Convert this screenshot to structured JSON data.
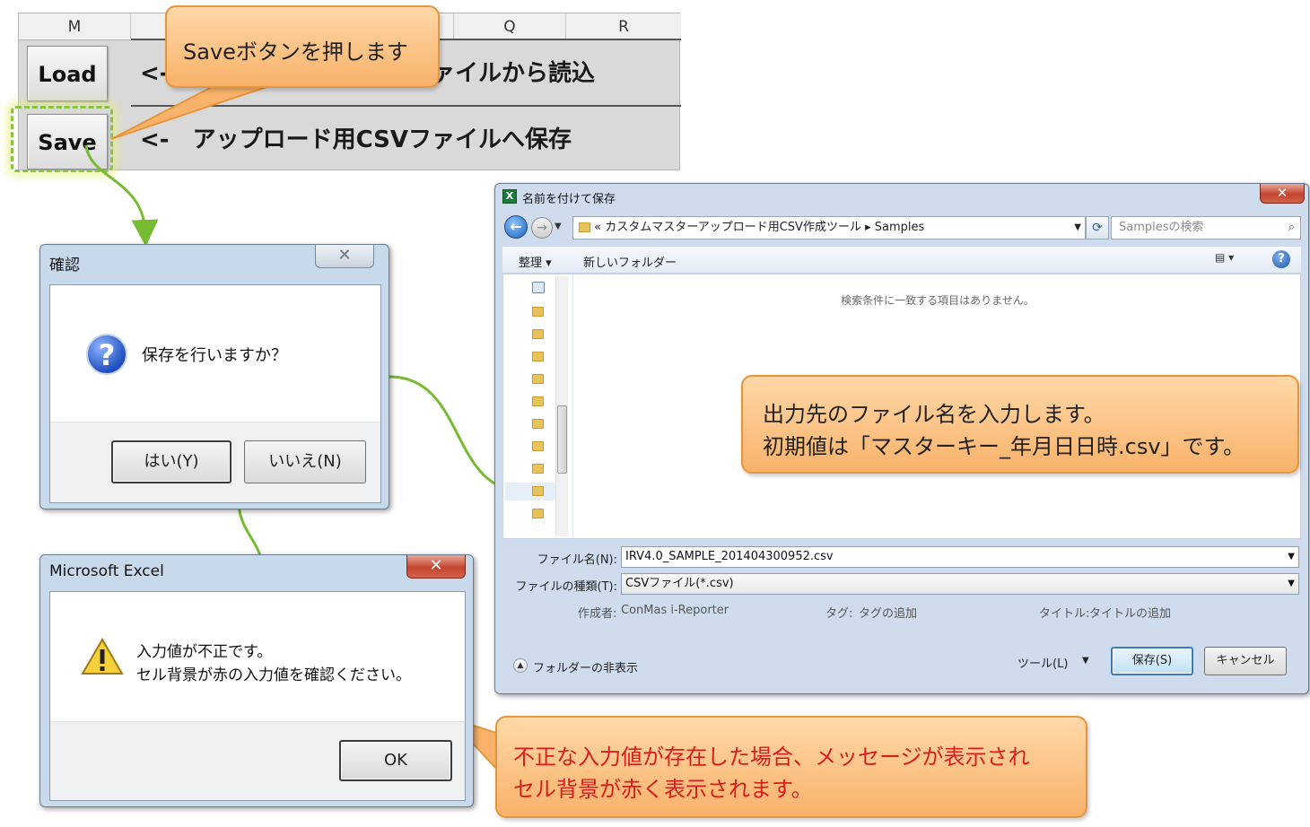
{
  "sheet": {
    "columns": [
      "M",
      "",
      "",
      "Q",
      "R"
    ],
    "load_label": "Load",
    "save_label": "Save",
    "row1_text": "<-　アップロード用CSVファイルから読込",
    "row2_text": "<-　アップロード用CSVファイルへ保存"
  },
  "callouts": {
    "save": "Saveボタンを押します",
    "filename_line1": "出力先のファイル名を入力します。",
    "filename_line2": "初期値は「マスターキー_年月日日時.csv」です。",
    "error_line1": "不正な入力値が存在した場合、メッセージが表示され",
    "error_line2": "セル背景が赤く表示されます。"
  },
  "confirm_dialog": {
    "title": "確認",
    "close": "✕",
    "message": "保存を行いますか？",
    "yes_label": "はい(Y)",
    "no_label": "いいえ(N)",
    "icon": "question-icon"
  },
  "excel_dialog": {
    "title": "Microsoft Excel",
    "close": "✕",
    "line1": "入力値が不正です。",
    "line2": "セル背景が赤の入力値を確認ください。",
    "ok_label": "OK",
    "icon": "warning-icon"
  },
  "save_as": {
    "title": "名前を付けて保存",
    "close": "✕",
    "breadcrumb_prefix": "«",
    "breadcrumb_folder": "カスタムマスターアップロード用CSV作成ツール",
    "breadcrumb_sep": "▸",
    "breadcrumb_current": "Samples",
    "search_placeholder": "Samplesの検索",
    "organize_label": "整理 ▾",
    "new_folder_label": "新しいフォルダー",
    "empty_message": "検索条件に一致する項目はありません。",
    "filename_label": "ファイル名(N):",
    "filename_value": "IRV4.0_SAMPLE_201404300952.csv",
    "filetype_label": "ファイルの種類(T):",
    "filetype_value": "CSVファイル(*.csv)",
    "author_label": "作成者:",
    "author_value": "ConMas i-Reporter",
    "tags_label": "タグ:",
    "tags_value": "タグの追加",
    "title_field_label": "タイトル:",
    "title_field_value": "タイトルの追加",
    "hide_folders_label": "フォルダーの非表示",
    "tools_label": "ツール(L)",
    "save_label": "保存(S)",
    "cancel_label": "キャンセル"
  },
  "colors": {
    "callout_fill": "#f8b26a",
    "callout_border": "#e6953c",
    "arrow_green": "#77bb33",
    "highlight": "#8ac43f",
    "error_text": "#d61e1e"
  }
}
